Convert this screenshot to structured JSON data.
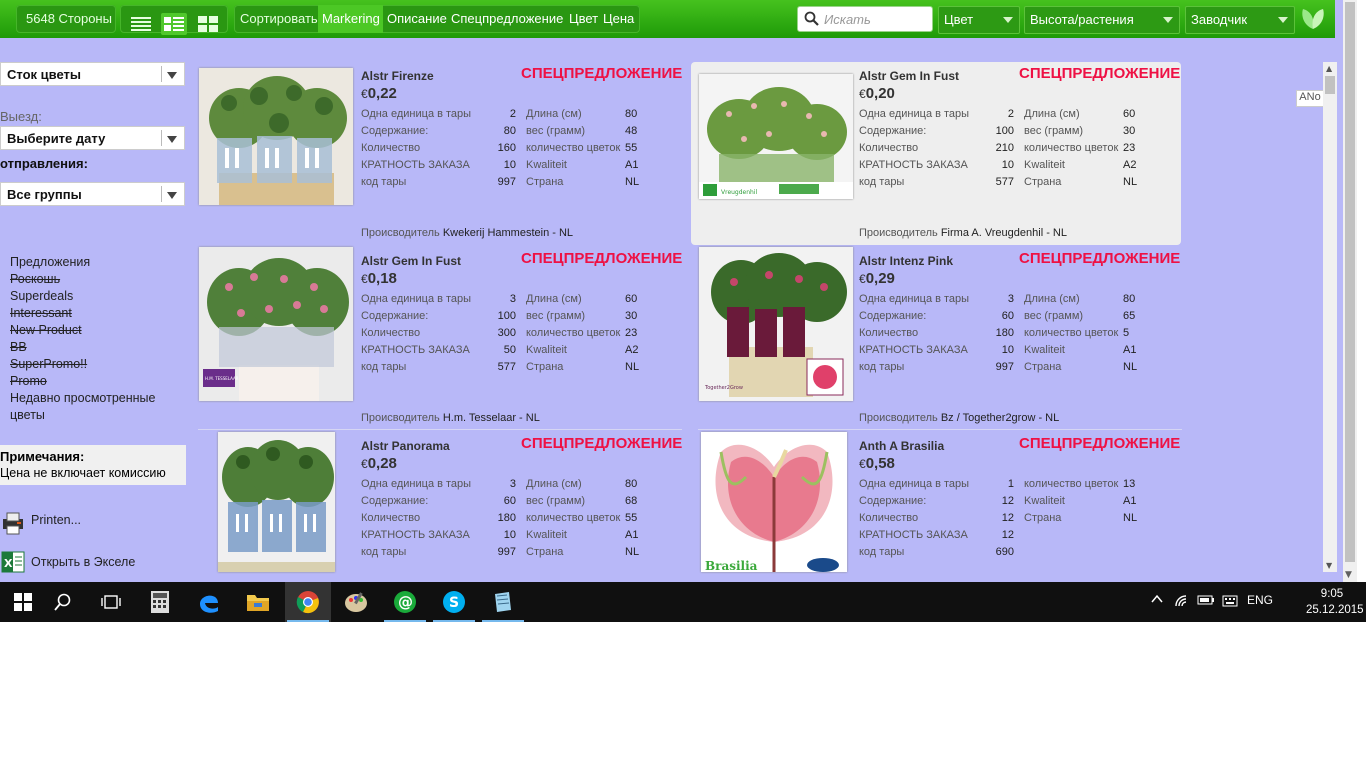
{
  "topbar": {
    "pages": "5648 Стороны",
    "sort_label": "Сортировать",
    "sort_options": [
      "Markering",
      "Описание",
      "Спецпредложение",
      "Цвет",
      "Цена"
    ],
    "search_placeholder": "Искать",
    "filters": [
      "Цвет",
      "Высота/растения",
      "Заводчик"
    ]
  },
  "sidebar": {
    "stock_select": "Сток цветы",
    "departure_label": "Выезд:",
    "date_select": "Выберите дату",
    "shipping_label": "отправления:",
    "group_select": "Все группы",
    "nav": [
      {
        "label": "Предложения",
        "struck": false
      },
      {
        "label": "Роскошь",
        "struck": true
      },
      {
        "label": "Superdeals",
        "struck": false
      },
      {
        "label": "Interessant",
        "struck": true
      },
      {
        "label": "New Product",
        "struck": true
      },
      {
        "label": "BB",
        "struck": true
      },
      {
        "label": "SuperPromo!!",
        "struck": true
      },
      {
        "label": "Promo",
        "struck": true
      },
      {
        "label": "Недавно просмотренные цветы",
        "struck": false
      }
    ],
    "notes_title": "Примечания:",
    "notes_text": "Цена не включает комиссию",
    "print": "Printen...",
    "excel": "Открыть в Экселе"
  },
  "labels": {
    "special": "СПЕЦПРЕДЛОЖЕНИЕ",
    "currency": "€",
    "producer": "Происводитель",
    "units_per_pack": "Одна единица в тары",
    "content": "Содержание:",
    "quantity": "Количество",
    "order_multiple": "КРАТНОСТЬ ЗАКАЗА",
    "pack_code": "код тары",
    "length": "Длина (см)",
    "weight": "вес (грамм)",
    "flower_count": "количество цветок",
    "quality": "Kwaliteit",
    "country": "Страна"
  },
  "products": [
    {
      "name": "Alstr Firenze",
      "price": "0,22",
      "units": "2",
      "content": "80",
      "quantity": "160",
      "multiple": "10",
      "code": "997",
      "right": [
        [
          "length",
          "80"
        ],
        [
          "weight",
          "48"
        ],
        [
          "flower_count",
          "55"
        ],
        [
          "quality",
          "A1"
        ],
        [
          "country",
          "NL"
        ]
      ],
      "producer": "Kwekerij Hammestein - NL"
    },
    {
      "name": "Alstr Gem In Fust",
      "price": "0,20",
      "units": "2",
      "content": "100",
      "quantity": "210",
      "multiple": "10",
      "code": "577",
      "right": [
        [
          "length",
          "60"
        ],
        [
          "weight",
          "30"
        ],
        [
          "flower_count",
          "23"
        ],
        [
          "quality",
          "A2"
        ],
        [
          "country",
          "NL"
        ]
      ],
      "producer": "Firma A. Vreugdenhil - NL"
    },
    {
      "name": "Alstr Gem In Fust",
      "price": "0,18",
      "units": "3",
      "content": "100",
      "quantity": "300",
      "multiple": "50",
      "code": "577",
      "right": [
        [
          "length",
          "60"
        ],
        [
          "weight",
          "30"
        ],
        [
          "flower_count",
          "23"
        ],
        [
          "quality",
          "A2"
        ],
        [
          "country",
          "NL"
        ]
      ],
      "producer": "H.m. Tesselaar - NL"
    },
    {
      "name": "Alstr Intenz Pink",
      "price": "0,29",
      "units": "3",
      "content": "60",
      "quantity": "180",
      "multiple": "10",
      "code": "997",
      "right": [
        [
          "length",
          "80"
        ],
        [
          "weight",
          "65"
        ],
        [
          "flower_count",
          "5"
        ],
        [
          "quality",
          "A1"
        ],
        [
          "country",
          "NL"
        ]
      ],
      "producer": "Bz / Together2grow - NL"
    },
    {
      "name": "Alstr Panorama",
      "price": "0,28",
      "units": "3",
      "content": "60",
      "quantity": "180",
      "multiple": "10",
      "code": "997",
      "right": [
        [
          "length",
          "80"
        ],
        [
          "weight",
          "68"
        ],
        [
          "flower_count",
          "55"
        ],
        [
          "quality",
          "A1"
        ],
        [
          "country",
          "NL"
        ]
      ],
      "producer": ""
    },
    {
      "name": "Anth A Brasilia",
      "price": "0,58",
      "units": "1",
      "content": "12",
      "quantity": "12",
      "multiple": "12",
      "code": "690",
      "right": [
        [
          "flower_count",
          "13"
        ],
        [
          "quality",
          "A1"
        ],
        [
          "country",
          "NL"
        ]
      ],
      "producer": ""
    }
  ],
  "photo_texts": {
    "p2_logo": "Vreugdenhil",
    "p3_logo": "H.M. TESSELAAR",
    "p4_logo": "Together2Grow",
    "p6_logo": "Brasilia"
  },
  "ano_button": "ANo",
  "taskbar": {
    "lang": "ENG",
    "time": "9:05",
    "date": "25.12.2015"
  }
}
